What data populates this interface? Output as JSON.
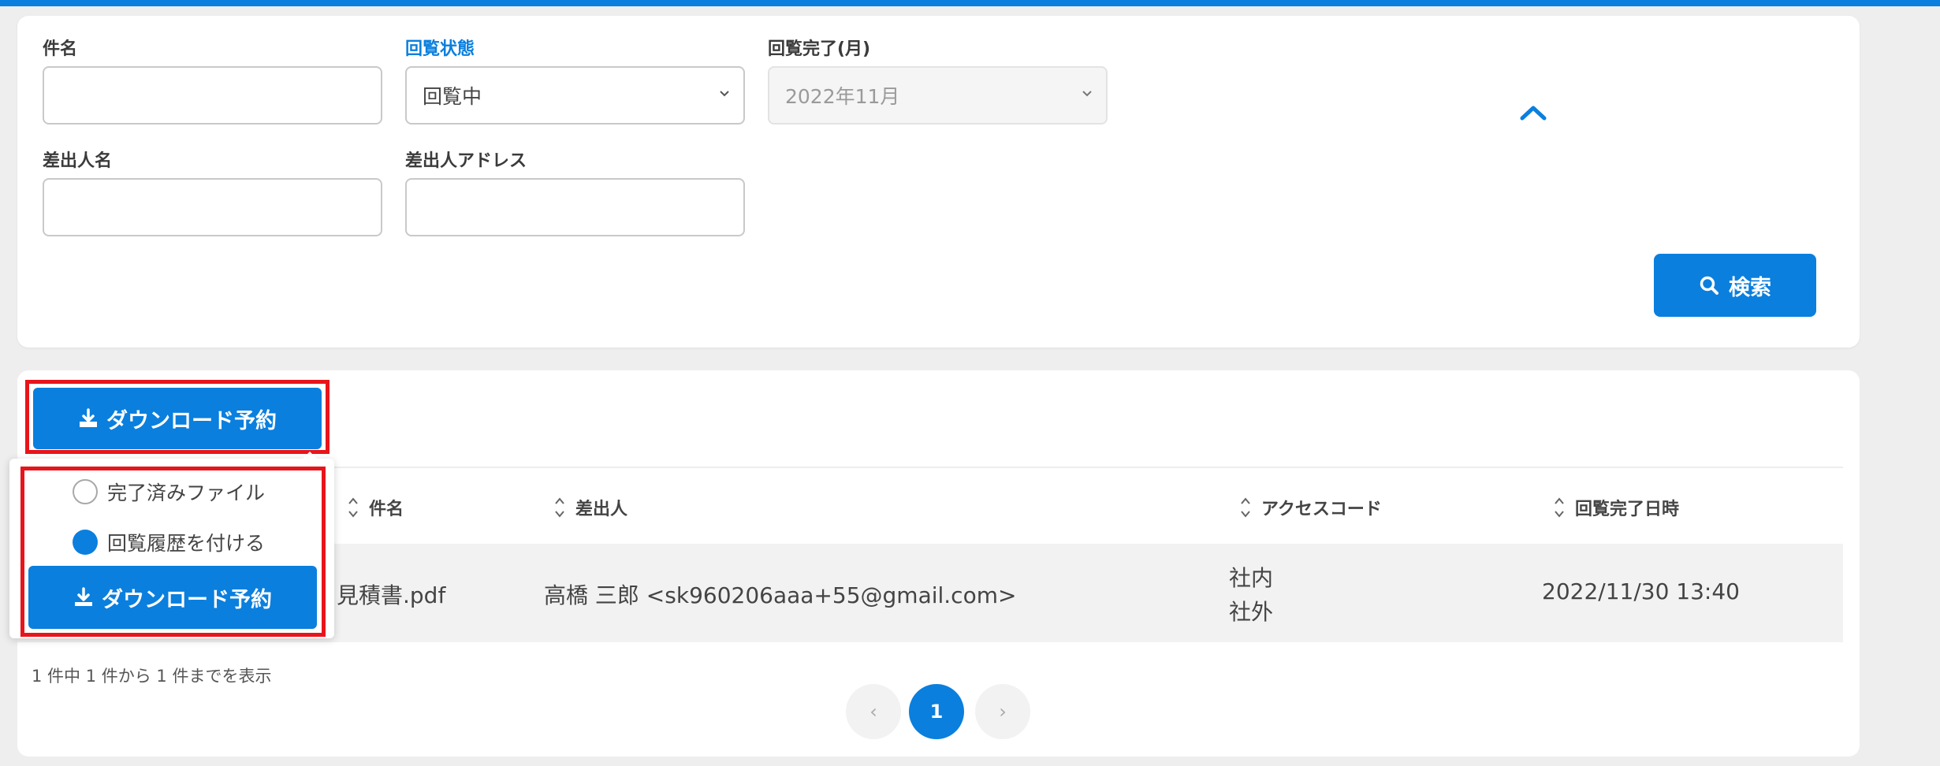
{
  "search": {
    "subject_label": "件名",
    "subject_value": "",
    "status_label": "回覧状態",
    "status_value": "回覧中",
    "completed_label": "回覧完了(月)",
    "completed_value": "2022年11月",
    "sender_name_label": "差出人名",
    "sender_name_value": "",
    "sender_address_label": "差出人アドレス",
    "sender_address_value": "",
    "search_button": "検索"
  },
  "actions": {
    "download_button": "ダウンロード予約"
  },
  "popover": {
    "options": [
      {
        "label": "完了済みファイル",
        "checked": false
      },
      {
        "label": "回覧履歴を付ける",
        "checked": true
      }
    ],
    "submit_button": "ダウンロード予約"
  },
  "table": {
    "headers": [
      "件名",
      "差出人",
      "アクセスコード",
      "回覧完了日時"
    ],
    "rows": [
      {
        "subject": "見積書.pdf",
        "sender": "高橋 三郎 <sk960206aaa+55@gmail.com>",
        "access_code_1": "社内",
        "access_code_2": "社外",
        "completed_at": "2022/11/30 13:40"
      }
    ]
  },
  "summary": "1 件中 1 件から 1 件までを表示",
  "pagination": {
    "prev": "‹",
    "current": "1",
    "next": "›"
  },
  "colors": {
    "accent": "#0a7fde",
    "highlight": "#e8141b"
  }
}
